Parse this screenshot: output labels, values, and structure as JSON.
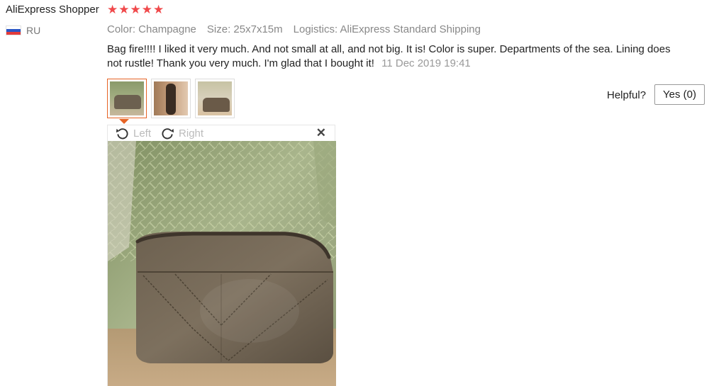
{
  "review": {
    "reviewer": "AliExpress Shopper",
    "rating": 5,
    "country": "RU",
    "meta": {
      "color": "Color: Champagne",
      "size": "Size: 25x7x15m",
      "logistics": "Logistics: AliExpress Standard Shipping"
    },
    "text": "Bag fire!!!! I liked it very much. And not small at all, and not big. It is! Color is super. Departments of the sea. Lining does not rustle! Thank you very much. I'm glad that I bought it!",
    "date": "11 Dec 2019 19:41"
  },
  "helpful": {
    "label": "Helpful?",
    "yes_label": "Yes (0)"
  },
  "viewer": {
    "rotate_left": "Left",
    "rotate_right": "Right"
  },
  "icons": {
    "star": "star-icon",
    "flag": "russia-flag-icon",
    "rotate_left": "rotate-left-icon",
    "rotate_right": "rotate-right-icon",
    "close": "close-icon"
  },
  "colors": {
    "star": "#f0494b",
    "active_thumb": "#e66325",
    "meta_text": "#888888"
  }
}
